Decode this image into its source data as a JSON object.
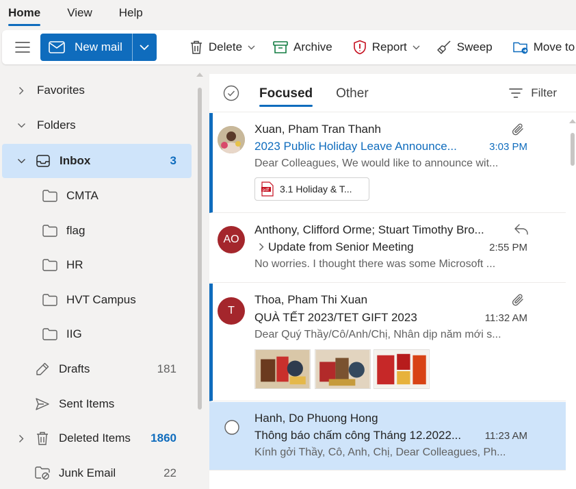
{
  "top_tabs": [
    {
      "label": "Home"
    },
    {
      "label": "View"
    },
    {
      "label": "Help"
    }
  ],
  "ribbon": {
    "new_mail": "New mail",
    "delete": "Delete",
    "archive": "Archive",
    "report": "Report",
    "sweep": "Sweep",
    "move_to": "Move to"
  },
  "sidebar": {
    "items": [
      {
        "label": "Favorites",
        "count": ""
      },
      {
        "label": "Folders",
        "count": ""
      },
      {
        "label": "Inbox",
        "count": "3"
      },
      {
        "label": "CMTA",
        "count": ""
      },
      {
        "label": "flag",
        "count": ""
      },
      {
        "label": "HR",
        "count": ""
      },
      {
        "label": "HVT Campus",
        "count": ""
      },
      {
        "label": "IIG",
        "count": ""
      },
      {
        "label": "Drafts",
        "count": "181"
      },
      {
        "label": "Sent Items",
        "count": ""
      },
      {
        "label": "Deleted Items",
        "count": "1860"
      },
      {
        "label": "Junk Email",
        "count": "22"
      }
    ]
  },
  "list": {
    "tabs": [
      {
        "label": "Focused"
      },
      {
        "label": "Other"
      }
    ],
    "filter": "Filter",
    "messages": [
      {
        "sender": "Xuan, Pham Tran Thanh",
        "subject": "2023 Public Holiday Leave Announce...",
        "time": "3:03 PM",
        "preview": "Dear Colleagues, We would like to announce wit...",
        "attachment": "3.1 Holiday & T..."
      },
      {
        "avatar": "AO",
        "sender": "Anthony, Clifford Orme; Stuart Timothy Bro...",
        "subject": "Update from Senior Meeting",
        "time": "2:55 PM",
        "preview": "No worries. I thought there was some Microsoft ..."
      },
      {
        "avatar": "T",
        "sender": "Thoa, Pham Thi Xuan",
        "subject": "QUÀ TẾT 2023/TET GIFT 2023",
        "time": "11:32 AM",
        "preview": "Dear Quý Thầy/Cô/Anh/Chị, Nhân dịp năm mới s..."
      },
      {
        "sender": "Hanh, Do Phuong Hong",
        "subject": "Thông báo chấm công Tháng 12.2022...",
        "time": "11:23 AM",
        "preview": "Kính gởi Thầy, Cô, Anh, Chị, Dear Colleagues, Ph..."
      }
    ]
  },
  "colors": {
    "accent": "#0f6cbd",
    "selected_bg": "#cfe4fa",
    "avatar_red": "#a4262c"
  }
}
